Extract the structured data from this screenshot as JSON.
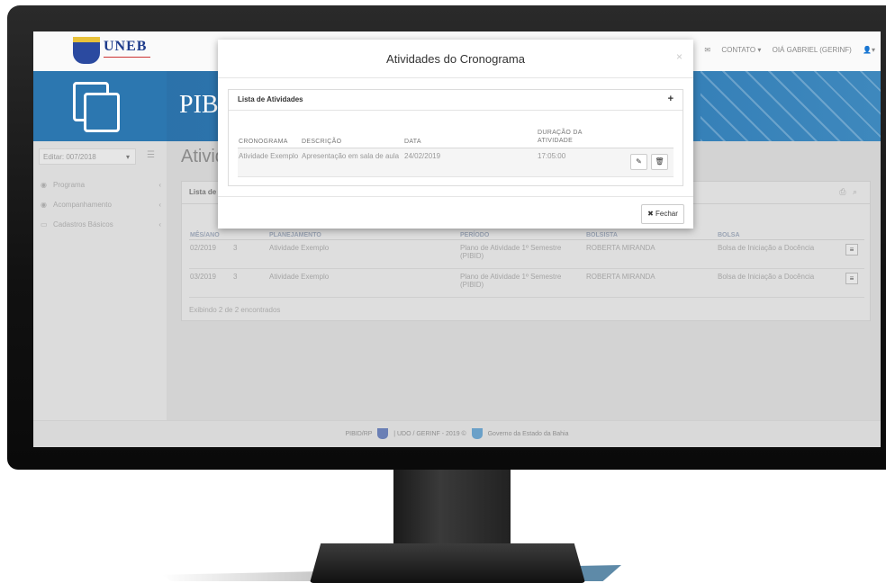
{
  "app": {
    "logo_text": "UNEB",
    "banner_text": "PIB",
    "top_nav": {
      "contato": "CONTATO",
      "user": "OIÁ GABRIEL (GERINF)"
    }
  },
  "sidebar": {
    "period_select": "Editar: 007/2018",
    "items": [
      {
        "label": "Programa",
        "icon": "eye-icon"
      },
      {
        "label": "Acompanhamento",
        "icon": "eye-icon"
      },
      {
        "label": "Cadastros Básicos",
        "icon": "folder-icon"
      }
    ]
  },
  "main": {
    "title": "Ativid",
    "panel_title": "Lista de",
    "columns": [
      "MÊS/ANO",
      "",
      "PLANEJAMENTO",
      "PERÍODO",
      "BOLSISTA",
      "BOLSA"
    ],
    "rows": [
      {
        "mes": "02/2019",
        "num": "3",
        "planejamento": "Atividade Exemplo",
        "periodo": "Plano de Atividade 1º Semestre (PIBID)",
        "bolsista": "ROBERTA MIRANDA",
        "bolsa": "Bolsa de Iniciação a Docência"
      },
      {
        "mes": "03/2019",
        "num": "3",
        "planejamento": "Atividade Exemplo",
        "periodo": "Plano de Atividade 1º Semestre (PIBID)",
        "bolsista": "ROBERTA MIRANDA",
        "bolsa": "Bolsa de Iniciação a Docência"
      }
    ],
    "exibindo": "Exibindo 2 de 2 encontrados"
  },
  "footer": {
    "left": "PIBID/RP",
    "right": "| UDO / GERINF - 2019 ©",
    "gov": "Governo da Estado da Bahia"
  },
  "modal": {
    "title": "Atividades do Cronograma",
    "close_label": "×",
    "list_title": "Lista de Atividades",
    "add_label": "+",
    "columns": [
      "CRONOGRAMA",
      "DESCRIÇÃO",
      "DATA",
      "DURAÇÃO DA ATIVIDADE"
    ],
    "rows": [
      {
        "cronograma": "Atividade Exemplo",
        "descricao": "Apresentação em sala de aula",
        "data": "24/02/2019",
        "duracao": "17:05:00"
      }
    ],
    "close_button": "Fechar"
  }
}
